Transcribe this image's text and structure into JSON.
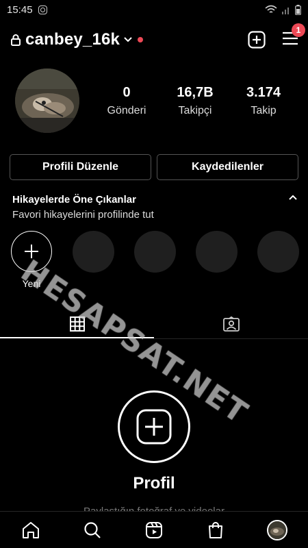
{
  "status_bar": {
    "time": "15:45"
  },
  "header": {
    "username": "canbey_16k",
    "notification_count": "1"
  },
  "stats": [
    {
      "value": "0",
      "label": "Gönderi"
    },
    {
      "value": "16,7B",
      "label": "Takipçi"
    },
    {
      "value": "3.174",
      "label": "Takip"
    }
  ],
  "buttons": {
    "edit_profile": "Profili Düzenle",
    "saved": "Kaydedilenler"
  },
  "highlights": {
    "title": "Hikayelerde Öne Çıkanlar",
    "subtitle": "Favori hikayelerini profilinde tut",
    "new_label": "Yeni"
  },
  "watermark": "HESAPSAT.NET",
  "empty_state": {
    "title": "Profil",
    "subtitle": "Paylaştığın fotoğraf ve videolar"
  },
  "colors": {
    "accent": "#ed4956",
    "background": "#000000",
    "border": "#555555"
  },
  "icons": [
    "lock-icon",
    "chevron-down-icon",
    "new-post-icon",
    "menu-icon",
    "grid-icon",
    "tagged-icon",
    "home-icon",
    "search-icon",
    "reels-icon",
    "shop-icon"
  ]
}
